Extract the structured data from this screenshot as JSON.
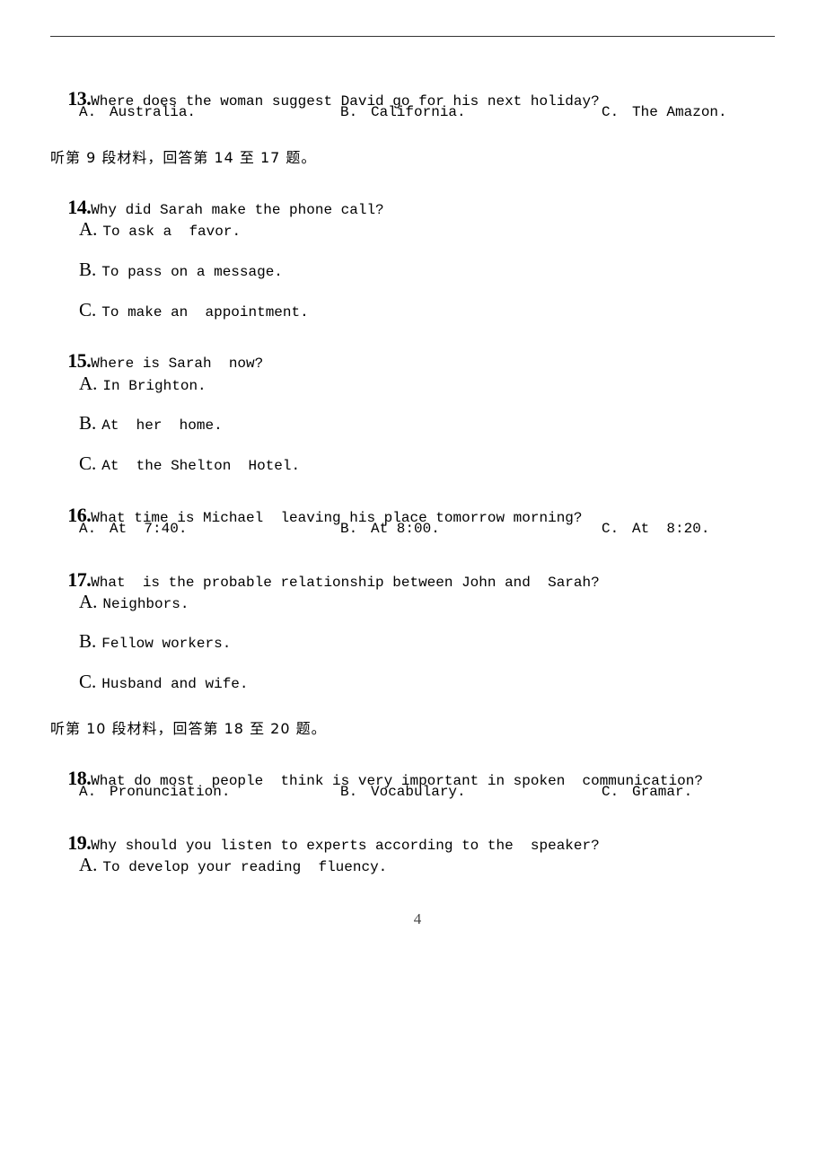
{
  "page_number": "4",
  "sections": {
    "s9": "听第 9 段材料，回答第 14 至 17 题。",
    "s10": "听第 10 段材料，回答第 18 至 20 题。"
  },
  "questions": {
    "q13": {
      "num": "13.",
      "text": "Where does the woman suggest David go for his next holiday?",
      "options": [
        {
          "letter": "A.",
          "text": "Australia."
        },
        {
          "letter": "B.",
          "text": "California."
        },
        {
          "letter": "C.",
          "text": "The Amazon."
        }
      ]
    },
    "q14": {
      "num": "14.",
      "text": "Why did Sarah make the phone call?",
      "options": [
        {
          "letter": "A.",
          "text": "To ask a  favor."
        },
        {
          "letter": "B.",
          "text": "To pass on a message."
        },
        {
          "letter": "C.",
          "text": "To make an  appointment."
        }
      ]
    },
    "q15": {
      "num": "15.",
      "text": "Where is Sarah  now?",
      "options": [
        {
          "letter": "A.",
          "text": "In Brighton."
        },
        {
          "letter": "B.",
          "text": "At  her  home."
        },
        {
          "letter": "C.",
          "text": "At  the Shelton  Hotel."
        }
      ]
    },
    "q16": {
      "num": "16.",
      "text": "What time is Michael  leaving his place tomorrow morning?",
      "options": [
        {
          "letter": "A.",
          "text": "At  7:40."
        },
        {
          "letter": "B.",
          "text": "At 8:00."
        },
        {
          "letter": "C.",
          "text": "At  8:20."
        }
      ]
    },
    "q17": {
      "num": "17.",
      "text": "What  is the probable relationship between John and  Sarah?",
      "options": [
        {
          "letter": "A.",
          "text": "Neighbors."
        },
        {
          "letter": "B.",
          "text": "Fellow workers."
        },
        {
          "letter": "C.",
          "text": "Husband and wife."
        }
      ]
    },
    "q18": {
      "num": "18.",
      "text": "What do most  people  think is very important in spoken  communication?",
      "options": [
        {
          "letter": "A.",
          "text": "Pronunciation."
        },
        {
          "letter": "B.",
          "text": "Vocabulary."
        },
        {
          "letter": "C.",
          "text": "Gramar."
        }
      ]
    },
    "q19": {
      "num": "19.",
      "text": "Why should you listen to experts according to the  speaker?",
      "options": [
        {
          "letter": "A.",
          "text": "To develop your reading  fluency."
        }
      ]
    }
  }
}
